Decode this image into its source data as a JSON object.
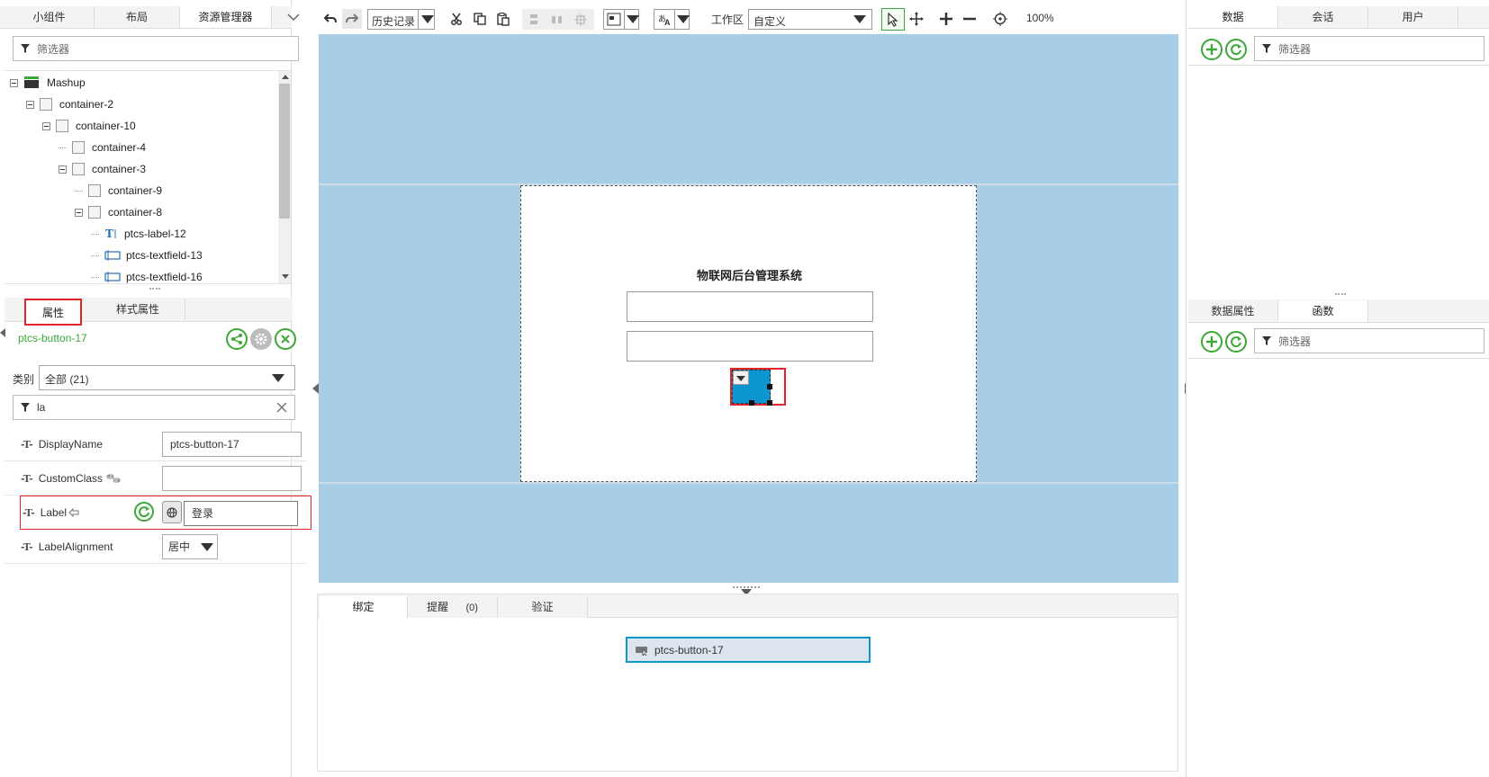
{
  "left_tabs": [
    "小组件",
    "布局",
    "资源管理器"
  ],
  "filter_placeholder": "筛选器",
  "tree": [
    {
      "label": "Mashup",
      "kind": "mashup",
      "depth": 0,
      "expanded": true
    },
    {
      "label": "container-2",
      "kind": "container",
      "depth": 1,
      "expanded": true
    },
    {
      "label": "container-10",
      "kind": "container",
      "depth": 2,
      "expanded": true
    },
    {
      "label": "container-4",
      "kind": "container",
      "depth": 3,
      "expanded": false
    },
    {
      "label": "container-3",
      "kind": "container",
      "depth": 3,
      "expanded": true
    },
    {
      "label": "container-9",
      "kind": "container",
      "depth": 4,
      "expanded": false
    },
    {
      "label": "container-8",
      "kind": "container",
      "depth": 4,
      "expanded": true
    },
    {
      "label": "ptcs-label-12",
      "kind": "label",
      "depth": 5,
      "expanded": false
    },
    {
      "label": "ptcs-textfield-13",
      "kind": "textfield",
      "depth": 5,
      "expanded": false
    },
    {
      "label": "ptcs-textfield-16",
      "kind": "textfield",
      "depth": 5,
      "expanded": false
    }
  ],
  "props_tabs": [
    "属性",
    "样式属性"
  ],
  "selected_widget": "ptcs-button-17",
  "category_label": "类别",
  "category_value": "全部 (21)",
  "prop_filter_value": "la",
  "properties": [
    {
      "name": "DisplayName",
      "value": "ptcs-button-17"
    },
    {
      "name": "CustomClass",
      "value": ""
    },
    {
      "name": "Label",
      "value": "登录"
    },
    {
      "name": "LabelAlignment",
      "value": "居中"
    }
  ],
  "toolbar": {
    "history_label": "历史记录",
    "workspace_label": "工作区",
    "workspace_value": "自定义",
    "zoom": "100%"
  },
  "canvas": {
    "title": "物联网后台管理系统"
  },
  "bottom_tabs": {
    "binding": "绑定",
    "alerts": "提醒",
    "alerts_count": "(0)",
    "validation": "验证"
  },
  "binding_item": "ptcs-button-17",
  "right_tabs_top": [
    "数据",
    "会话",
    "用户"
  ],
  "right_tabs_bottom": [
    "数据属性",
    "函数"
  ],
  "colors": {
    "accent_green": "#3aa935",
    "canvas_bg": "#a7cde7",
    "button_blue": "#0e96d1",
    "highlight_red": "#e0242b"
  }
}
